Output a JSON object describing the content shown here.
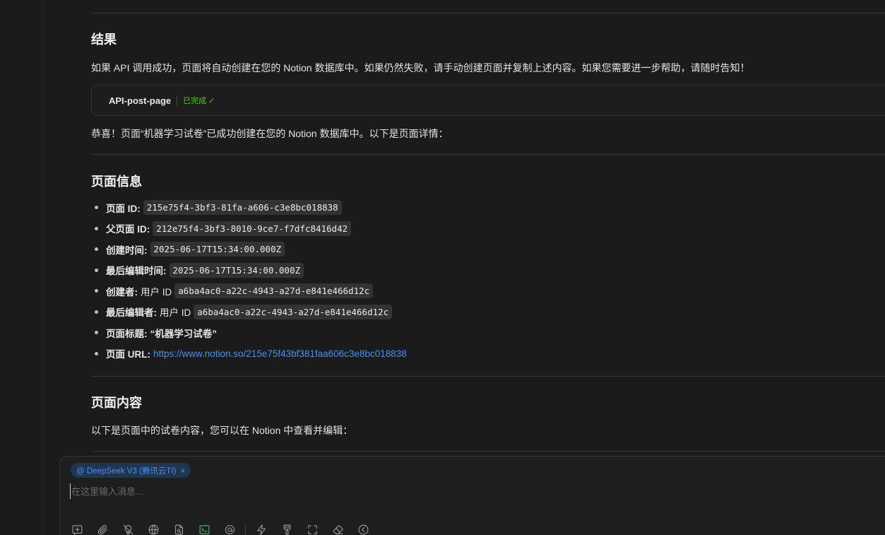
{
  "sections": {
    "result_heading": "结果",
    "result_text": "如果 API 调用成功，页面将自动创建在您的 Notion 数据库中。如果仍然失败，请手动创建页面并复制上述内容。如果您需要进一步帮助，请随时告知！",
    "tool_call": {
      "name": "API-post-page",
      "status": "已完成 ✓"
    },
    "congrats_text": "恭喜！页面“机器学习试卷”已成功创建在您的 Notion 数据库中。以下是页面详情：",
    "page_info_heading": "页面信息",
    "page_info": {
      "page_id_label": "页面 ID:",
      "page_id": "215e75f4-3bf3-81fa-a606-c3e8bc018838",
      "parent_id_label": "父页面 ID:",
      "parent_id": "212e75f4-3bf3-8010-9ce7-f7dfc8416d42",
      "created_label": "创建时间:",
      "created": "2025-06-17T15:34:00.000Z",
      "edited_label": "最后编辑时间:",
      "edited": "2025-06-17T15:34:00.000Z",
      "creator_label": "创建者:",
      "creator_prefix": "用户 ID",
      "creator_id": "a6ba4ac0-a22c-4943-a27d-e841e466d12c",
      "editor_label": "最后编辑者:",
      "editor_prefix": "用户 ID",
      "editor_id": "a6ba4ac0-a22c-4943-a27d-e841e466d12c",
      "title_label": "页面标题:",
      "title_value": "“机器学习试卷”",
      "url_label": "页面 URL:",
      "url": "https://www.notion.so/215e75f43bf381faa606c3e8bc018838"
    },
    "page_content_heading": "页面内容",
    "page_content_text": "以下是页面中的试卷内容，您可以在 Notion 中查看并编辑："
  },
  "composer": {
    "model_chip": "@ DeepSeek V3 (腾讯云TI)",
    "chip_close": "×",
    "placeholder": "在这里输入消息...",
    "toolbar_icons": [
      "new-topic-icon",
      "attachment-icon",
      "lightbulb-off-icon",
      "globe-icon",
      "file-search-icon",
      "terminal-icon",
      "at-icon",
      "lightning-icon",
      "paintbrush-icon",
      "fullscreen-icon",
      "eraser-icon",
      "collapse-icon"
    ],
    "active_color": "#3cc26a",
    "accent_color": "#4a8ff0"
  }
}
